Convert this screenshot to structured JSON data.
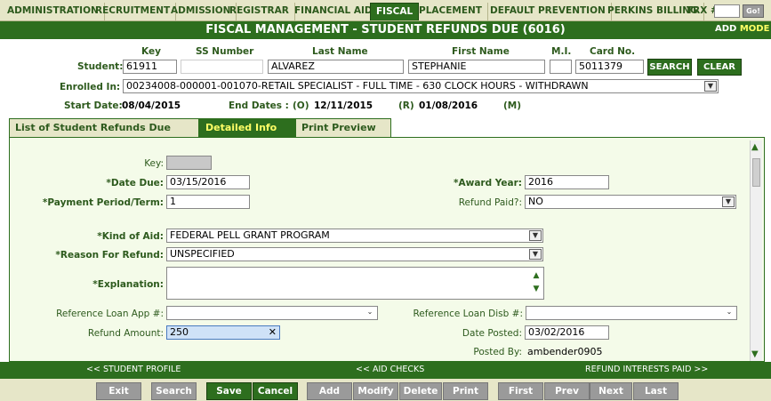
{
  "nav": {
    "tabs": [
      "ADMINISTRATION",
      "RECRUITMENT",
      "ADMISSION",
      "REGISTRAR",
      "FINANCIAL AID",
      "FISCAL",
      "PLACEMENT",
      "DEFAULT PREVENTION",
      "PERKINS BILLING"
    ],
    "active_tab": "FISCAL",
    "trx_label": "TRX #:",
    "go_label": "Go!"
  },
  "title": "FISCAL MANAGEMENT - STUDENT REFUNDS DUE (6016)",
  "mode": {
    "add": "ADD",
    "mode": "MODE"
  },
  "student": {
    "label": "Student:",
    "key_hdr": "Key",
    "ssn_hdr": "SS Number",
    "last_hdr": "Last Name",
    "first_hdr": "First Name",
    "mi_hdr": "M.I.",
    "card_hdr": "Card No.",
    "key": "61911",
    "last": "ALVAREZ",
    "first": "STEPHANIE",
    "card": "5011379",
    "search_btn": "SEARCH",
    "clear_btn": "CLEAR"
  },
  "enrolled": {
    "label": "Enrolled In:",
    "value": "00234008-000001-001070-RETAIL SPECIALIST - FULL TIME - 630 CLOCK HOURS - WITHDRAWN"
  },
  "dates": {
    "start_label": "Start Date:",
    "start": "08/04/2015",
    "end_label": "End Dates :",
    "o_label": "(O)",
    "o_date": "12/11/2015",
    "r_label": "(R)",
    "r_date": "01/08/2016",
    "m_label": "(M)"
  },
  "subtabs": [
    "List of Student Refunds Due",
    "Detailed Info",
    "Print Preview"
  ],
  "form": {
    "key_label": "Key:",
    "date_due_label": "*Date Due:",
    "date_due": "03/15/2016",
    "period_label": "*Payment Period/Term:",
    "period": "1",
    "award_year_label": "*Award Year:",
    "award_year": "2016",
    "refund_paid_label": "Refund Paid?:",
    "refund_paid": "NO",
    "kind_label": "*Kind of Aid:",
    "kind": "FEDERAL PELL GRANT PROGRAM",
    "reason_label": "*Reason For Refund:",
    "reason": "UNSPECIFIED",
    "explanation_label": "*Explanation:",
    "loan_app_label": "Reference Loan App #:",
    "loan_disb_label": "Reference Loan Disb #:",
    "amount_label": "Refund Amount:",
    "amount": "250",
    "date_posted_label": "Date Posted:",
    "date_posted": "03/02/2016",
    "posted_by_label": "Posted By:",
    "posted_by": "ambender0905"
  },
  "links": {
    "profile": "<< STUDENT PROFILE",
    "aid_checks": "<< AID CHECKS",
    "interests": "REFUND INTERESTS PAID >>"
  },
  "toolbar": {
    "exit": "Exit",
    "search": "Search",
    "save": "Save",
    "cancel": "Cancel",
    "add": "Add",
    "modify": "Modify",
    "delete": "Delete",
    "print": "Print",
    "first": "First",
    "prev": "Prev",
    "next": "Next",
    "last": "Last"
  }
}
